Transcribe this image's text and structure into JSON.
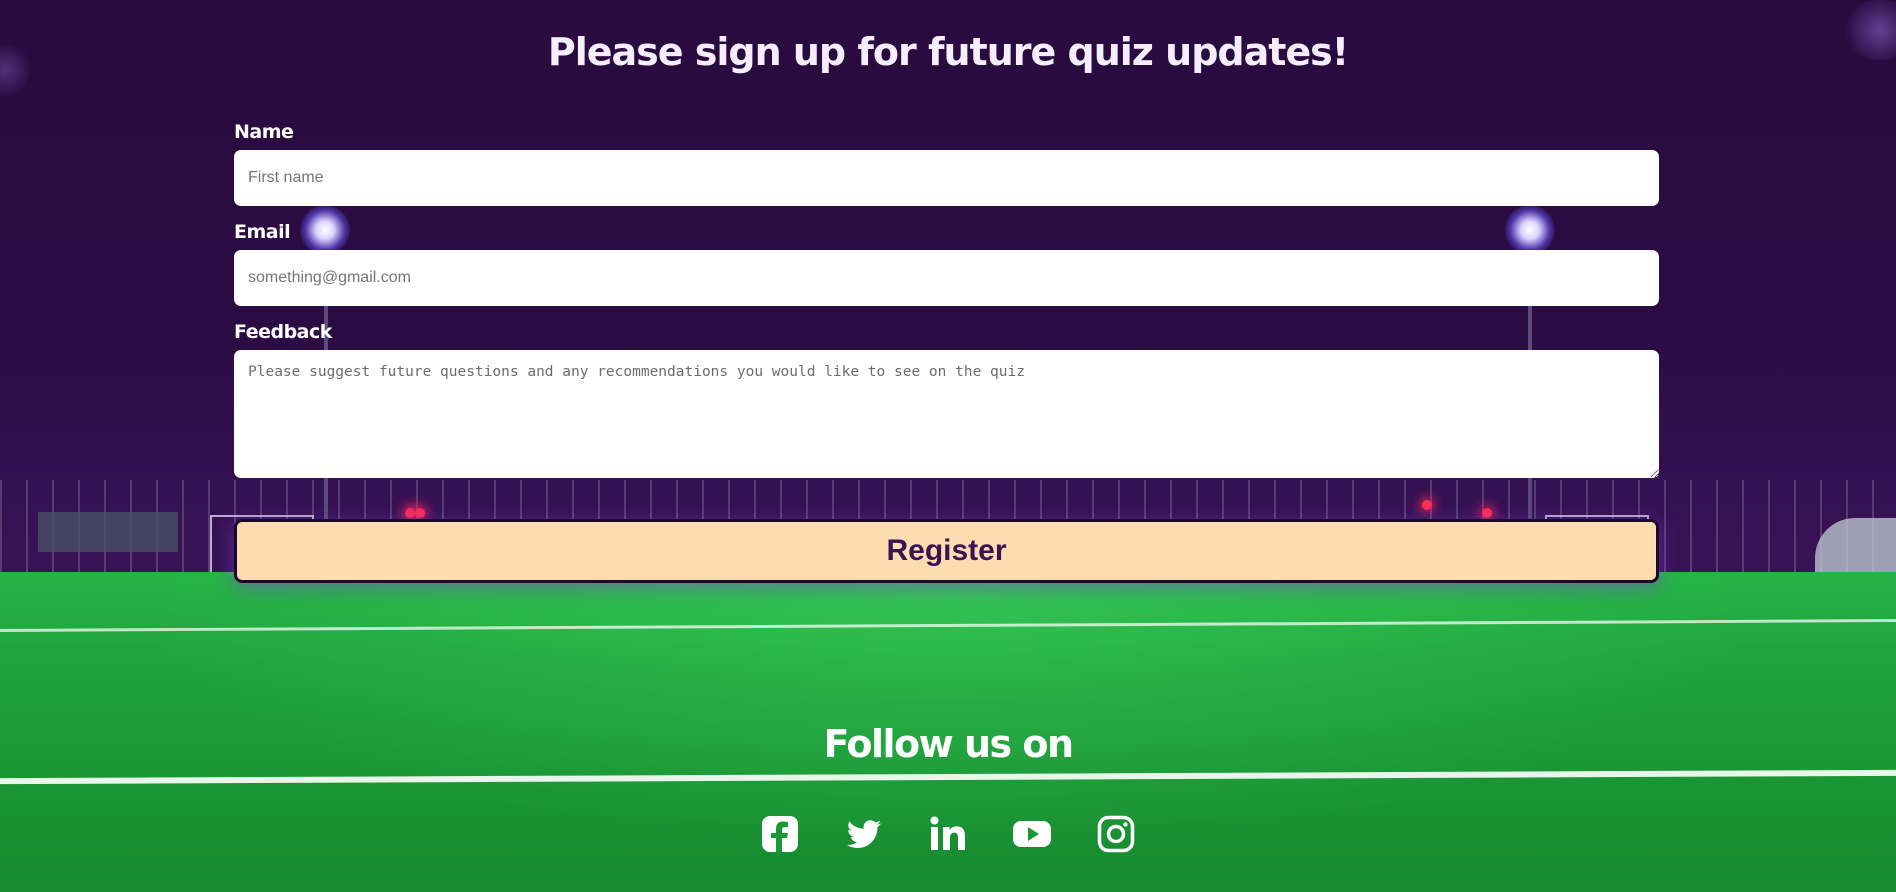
{
  "signup": {
    "title": "Please sign up for future quiz updates!",
    "name_label": "Name",
    "name_placeholder": "First name",
    "email_label": "Email",
    "email_placeholder": "something@gmail.com",
    "feedback_label": "Feedback",
    "feedback_placeholder": "Please suggest future questions and any recommendations you would like to see on the quiz",
    "register_label": "Register"
  },
  "footer": {
    "follow_label": "Follow us on",
    "socials": [
      {
        "icon": "facebook-icon"
      },
      {
        "icon": "twitter-icon"
      },
      {
        "icon": "linkedin-icon"
      },
      {
        "icon": "youtube-icon"
      },
      {
        "icon": "instagram-icon"
      }
    ]
  },
  "colors": {
    "background": "#2a0b3f",
    "button_bg": "#fddcb0",
    "button_text": "#3b1354",
    "text": "#ffffff"
  }
}
